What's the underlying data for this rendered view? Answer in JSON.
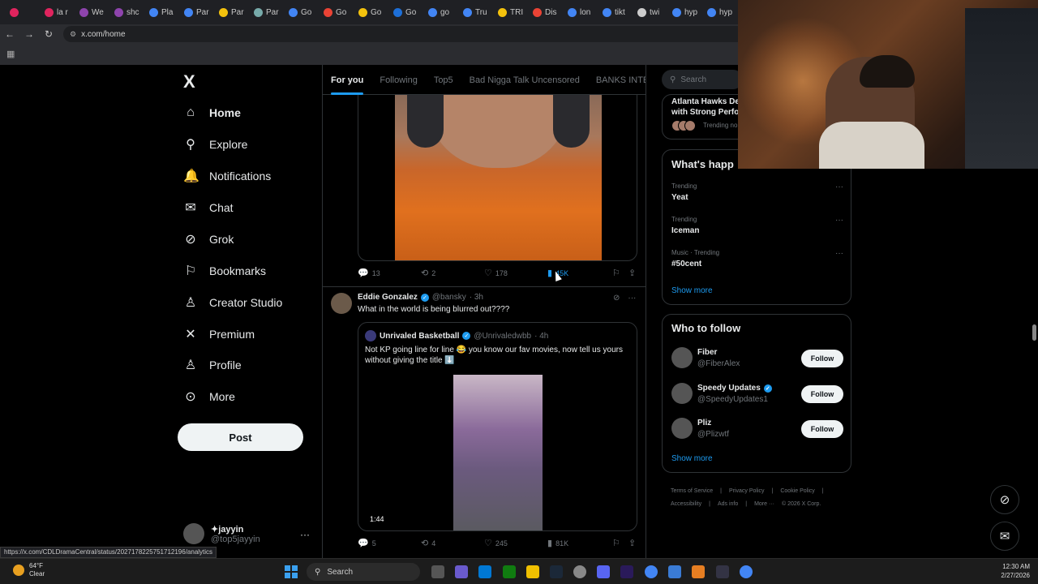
{
  "browser": {
    "tabs": [
      {
        "label": "",
        "color": "#e0245e"
      },
      {
        "label": "la r",
        "color": "#e0245e"
      },
      {
        "label": "We",
        "color": "#8e44ad"
      },
      {
        "label": "shc",
        "color": "#8e44ad"
      },
      {
        "label": "Pla",
        "color": "#4285f4"
      },
      {
        "label": "Par",
        "color": "#4285f4"
      },
      {
        "label": "Par",
        "color": "#f4c20d"
      },
      {
        "label": "Par",
        "color": "#7aa"
      },
      {
        "label": "Go",
        "color": "#4285f4"
      },
      {
        "label": "Go",
        "color": "#ea4335"
      },
      {
        "label": "Go",
        "color": "#f4c20d"
      },
      {
        "label": "Go",
        "color": "#1d6fd8"
      },
      {
        "label": "go",
        "color": "#4285f4"
      },
      {
        "label": "Tru",
        "color": "#4285f4"
      },
      {
        "label": "TRI",
        "color": "#f4c20d"
      },
      {
        "label": "Dis",
        "color": "#ea4335"
      },
      {
        "label": "lon",
        "color": "#4285f4"
      },
      {
        "label": "tikt",
        "color": "#4285f4"
      },
      {
        "label": "twi",
        "color": "#ccc"
      },
      {
        "label": "hyp",
        "color": "#4285f4"
      },
      {
        "label": "hyp",
        "color": "#4285f4"
      }
    ],
    "url": "x.com/home",
    "status_url": "https://x.com/CDLDramaCentral/status/2027178225751712196/analytics"
  },
  "nav": {
    "logo": "X",
    "items": [
      {
        "label": "Home",
        "icon": "home-icon",
        "glyph": "⌂"
      },
      {
        "label": "Explore",
        "icon": "search-icon",
        "glyph": "⚲"
      },
      {
        "label": "Notifications",
        "icon": "bell-icon",
        "glyph": "🔔"
      },
      {
        "label": "Chat",
        "icon": "mail-icon",
        "glyph": "✉"
      },
      {
        "label": "Grok",
        "icon": "grok-icon",
        "glyph": "⊘"
      },
      {
        "label": "Bookmarks",
        "icon": "bookmark-icon",
        "glyph": "⚐"
      },
      {
        "label": "Creator Studio",
        "icon": "creator-icon",
        "glyph": "♙"
      },
      {
        "label": "Premium",
        "icon": "x-icon",
        "glyph": "✕"
      },
      {
        "label": "Profile",
        "icon": "person-icon",
        "glyph": "♙"
      },
      {
        "label": "More",
        "icon": "more-circle-icon",
        "glyph": "⊙"
      }
    ],
    "post_label": "Post",
    "account": {
      "name": "✦jayyin",
      "handle": "@top5jayyin",
      "more": "···"
    }
  },
  "feed": {
    "tabs": [
      {
        "label": "For you",
        "selected": true
      },
      {
        "label": "Following",
        "selected": false
      },
      {
        "label": "Top5",
        "selected": false
      },
      {
        "label": "Bad Nigga Talk Uncensored",
        "selected": false
      },
      {
        "label": "BANKS INTERN",
        "selected": false
      }
    ],
    "post1_actions": {
      "replies": "13",
      "reposts": "2",
      "likes": "178",
      "views": "45K"
    },
    "post2": {
      "name": "Eddie Gonzalez",
      "handle": "@bansky",
      "time": "· 3h",
      "text": "What in the world is being blurred out????",
      "quote": {
        "name": "Unrivaled Basketball",
        "handle": "@Unrivaledwbb",
        "time": "· 4h",
        "text": "Not KP going line for line 😂 you know our fav movies, now tell us yours without giving the title ⬇️",
        "video_length": "1:44"
      },
      "actions": {
        "replies": "5",
        "reposts": "4",
        "likes": "245",
        "views": "81K"
      }
    }
  },
  "right": {
    "search_placeholder": "Search",
    "news": {
      "title1": "Atlanta Hawks De",
      "title2": "with Strong Perfo",
      "sub": "Trending no"
    },
    "happening": {
      "title": "What's happ",
      "trends": [
        {
          "category": "Trending",
          "name": "Yeat"
        },
        {
          "category": "Trending",
          "name": "Iceman"
        },
        {
          "category": "Music · Trending",
          "name": "#50cent"
        }
      ],
      "show_more": "Show more"
    },
    "who_to_follow": {
      "title": "Who to follow",
      "accounts": [
        {
          "name": "Fiber",
          "handle": "@FiberAlex",
          "verified": false
        },
        {
          "name": "Speedy Updates",
          "handle": "@SpeedyUpdates1",
          "verified": true
        },
        {
          "name": "Pliz",
          "handle": "@Plizwtf",
          "verified": false
        }
      ],
      "follow_label": "Follow",
      "show_more": "Show more"
    },
    "footer": {
      "line1": [
        "Terms of Service",
        "|",
        "Privacy Policy",
        "|",
        "Cookie Policy",
        "|"
      ],
      "line2": [
        "Accessibility",
        "|",
        "Ads info",
        "|",
        "More ···",
        "© 2026 X Corp."
      ]
    }
  },
  "taskbar": {
    "weather_temp": "64°F",
    "weather_desc": "Clear",
    "search_label": "Search",
    "time": "12:30 AM",
    "date": "2/27/2026"
  }
}
